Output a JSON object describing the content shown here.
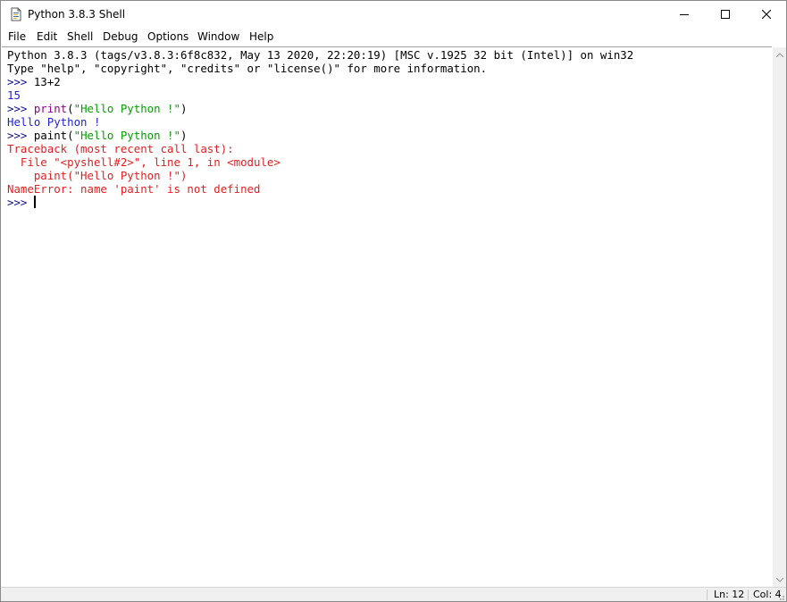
{
  "window": {
    "title": "Python 3.8.3 Shell",
    "icon": "idle-file-icon",
    "controls": {
      "minimize": "minimize-icon",
      "maximize": "maximize-icon",
      "close": "close-icon"
    }
  },
  "menu": [
    {
      "name": "menu-file",
      "label": "File"
    },
    {
      "name": "menu-edit",
      "label": "Edit"
    },
    {
      "name": "menu-shell",
      "label": "Shell"
    },
    {
      "name": "menu-debug",
      "label": "Debug"
    },
    {
      "name": "menu-options",
      "label": "Options"
    },
    {
      "name": "menu-window",
      "label": "Window"
    },
    {
      "name": "menu-help",
      "label": "Help"
    }
  ],
  "shell": {
    "lines": [
      [
        {
          "t": "Python 3.8.3 (tags/v3.8.3:6f8c832, May 13 2020, 22:20:19) [MSC v.1925 32 bit (Intel)] on win32",
          "k": "out"
        }
      ],
      [
        {
          "t": "Type \"help\", \"copyright\", \"credits\" or \"license()\" for more information.",
          "k": "out"
        }
      ],
      [
        {
          "t": ">>> ",
          "k": "prompt"
        },
        {
          "t": "13+2",
          "k": "out"
        }
      ],
      [
        {
          "t": "15",
          "k": "stdout"
        }
      ],
      [
        {
          "t": ">>> ",
          "k": "prompt"
        },
        {
          "t": "print",
          "k": "builtin"
        },
        {
          "t": "(",
          "k": "out"
        },
        {
          "t": "\"Hello Python !\"",
          "k": "str"
        },
        {
          "t": ")",
          "k": "out"
        }
      ],
      [
        {
          "t": "Hello Python !",
          "k": "stdout"
        }
      ],
      [
        {
          "t": ">>> ",
          "k": "prompt"
        },
        {
          "t": "paint(",
          "k": "out"
        },
        {
          "t": "\"Hello Python !\"",
          "k": "str"
        },
        {
          "t": ")",
          "k": "out"
        }
      ],
      [
        {
          "t": "Traceback (most recent call last):",
          "k": "err"
        }
      ],
      [
        {
          "t": "  File \"<pyshell#2>\", line 1, in <module>",
          "k": "err"
        }
      ],
      [
        {
          "t": "    paint(\"Hello Python !\")",
          "k": "err"
        }
      ],
      [
        {
          "t": "NameError: name 'paint' is not defined",
          "k": "err"
        }
      ],
      [
        {
          "t": ">>> ",
          "k": "prompt"
        },
        {
          "t": "",
          "k": "caret"
        }
      ]
    ]
  },
  "status": {
    "line": "Ln: 12",
    "col": "Col: 4"
  },
  "colors": {
    "prompt": "#0c0c8a",
    "builtin": "#900090",
    "string": "#00a000",
    "stdout": "#1f1fd2",
    "error": "#e02020"
  }
}
